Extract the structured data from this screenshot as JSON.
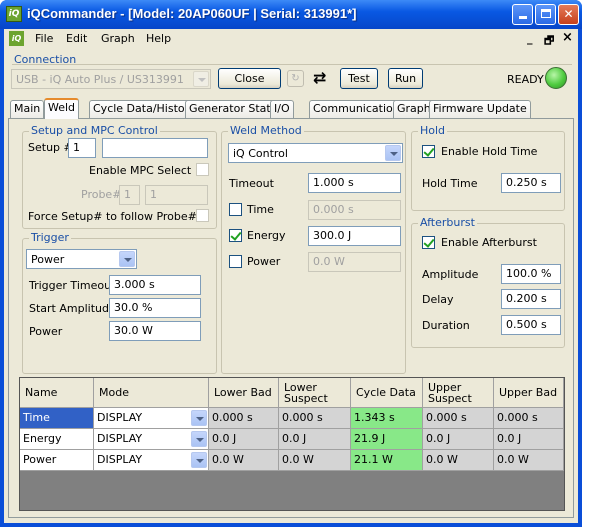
{
  "window": {
    "title": "iQCommander - [Model: 20AP060UF | Serial: 313991*]",
    "app_icon_text": "iQ",
    "controls": [
      "minimize",
      "maximize",
      "close"
    ]
  },
  "menubar": {
    "items": [
      "File",
      "Edit",
      "Graph",
      "Help"
    ],
    "mdi_controls": [
      "_",
      "🗗",
      "×"
    ]
  },
  "connection": {
    "group_label": "Connection",
    "port": "USB - iQ Auto Plus / US313991",
    "close_label": "Close",
    "test_label": "Test",
    "run_label": "Run",
    "status": "READY",
    "status_color": "#4fcb3f"
  },
  "tabs": [
    "Main",
    "Weld",
    "Cycle Data/History",
    "Generator Status",
    "I/O",
    "Communications",
    "Graph",
    "Firmware Update"
  ],
  "active_tab": "Weld",
  "setup": {
    "title": "Setup and MPC Control",
    "setup_label": "Setup #:",
    "setup_value": "1",
    "setup_name": "",
    "enable_mpc_label": "Enable MPC Select",
    "probe_label": "Probe#:",
    "probe_value": "1",
    "probe_value2": "1",
    "force_label": "Force Setup# to follow Probe#"
  },
  "trigger": {
    "title": "Trigger",
    "mode": "Power",
    "timeout_label": "Trigger Timeout",
    "timeout_value": "3.000 s",
    "start_amp_label": "Start Amplitude",
    "start_amp_value": "30.0 %",
    "power_label": "Power",
    "power_value": "30.0 W"
  },
  "weld_method": {
    "title": "Weld Method",
    "method": "iQ Control",
    "timeout_label": "Timeout",
    "timeout_value": "1.000 s",
    "time_label": "Time",
    "time_value": "0.000 s",
    "time_checked": false,
    "energy_label": "Energy",
    "energy_value": "300.0 J",
    "energy_checked": true,
    "power_label": "Power",
    "power_value": "0.0 W",
    "power_checked": false
  },
  "hold": {
    "title": "Hold",
    "enable_label": "Enable Hold Time",
    "enabled": true,
    "time_label": "Hold Time",
    "time_value": "0.250 s"
  },
  "afterburst": {
    "title": "Afterburst",
    "enable_label": "Enable Afterburst",
    "enabled": true,
    "amplitude_label": "Amplitude",
    "amplitude_value": "100.0 %",
    "delay_label": "Delay",
    "delay_value": "0.200 s",
    "duration_label": "Duration",
    "duration_value": "0.500 s"
  },
  "limits_table": {
    "columns": [
      "Name",
      "Mode",
      "Lower Bad",
      "Lower Suspect",
      "Cycle Data",
      "Upper Suspect",
      "Upper Bad"
    ],
    "rows": [
      {
        "name": "Time",
        "mode": "DISPLAY",
        "lower_bad": "0.000 s",
        "lower_suspect": "0.000 s",
        "cycle": "1.343 s",
        "upper_suspect": "0.000 s",
        "upper_bad": "0.000 s"
      },
      {
        "name": "Energy",
        "mode": "DISPLAY",
        "lower_bad": "0.0 J",
        "lower_suspect": "0.0 J",
        "cycle": "21.9 J",
        "upper_suspect": "0.0 J",
        "upper_bad": "0.0 J"
      },
      {
        "name": "Power",
        "mode": "DISPLAY",
        "lower_bad": "0.0 W",
        "lower_suspect": "0.0 W",
        "cycle": "21.1 W",
        "upper_suspect": "0.0 W",
        "upper_bad": "0.0 W"
      }
    ],
    "cycle_highlight_color": "#88e888",
    "selected_row_color": "#3161c6"
  }
}
